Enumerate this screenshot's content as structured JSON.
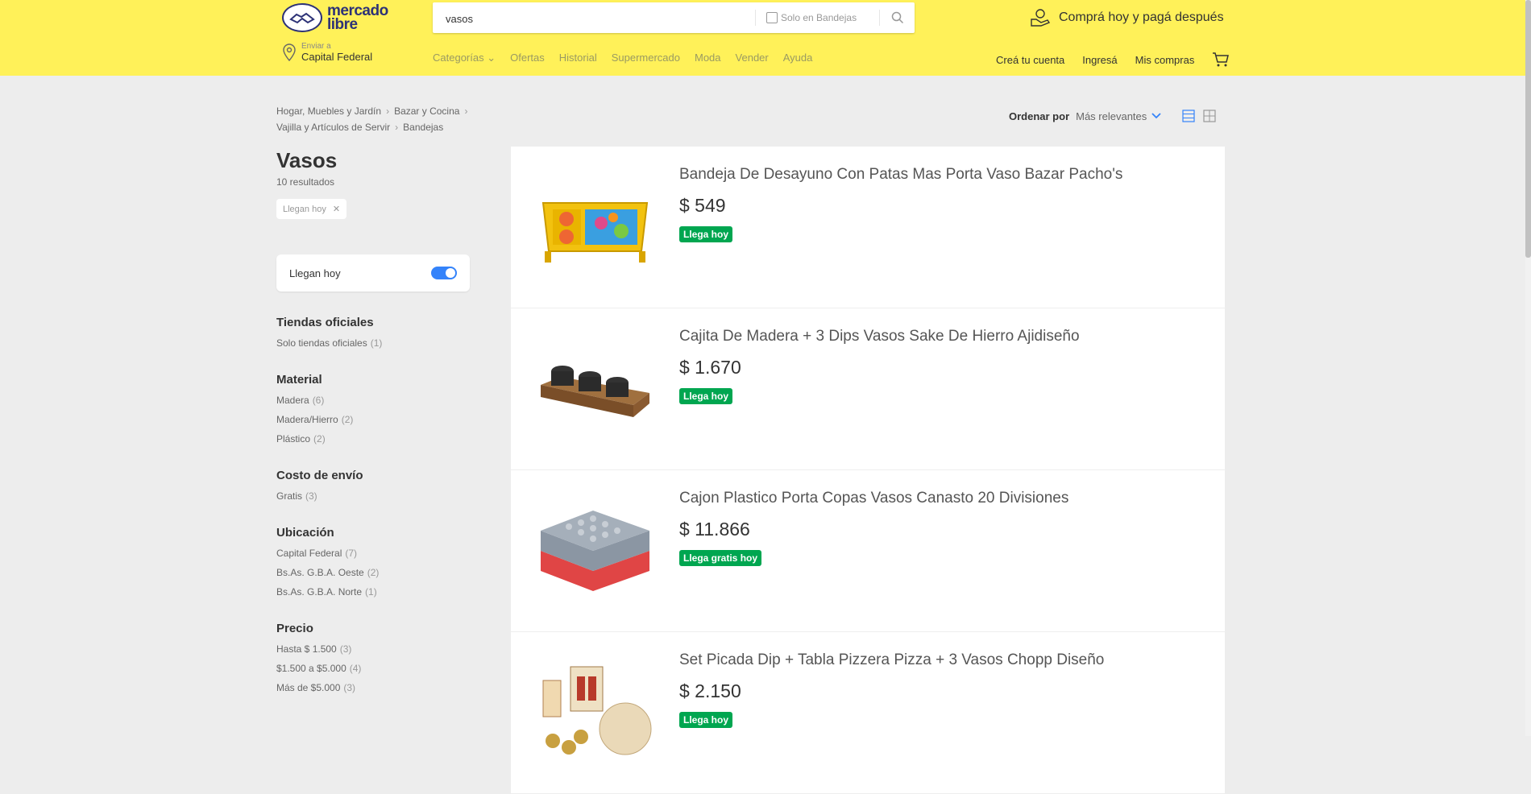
{
  "header": {
    "logo_line1": "mercado",
    "logo_line2": "libre",
    "search_value": "vasos",
    "search_checkbox_label": "Solo en Bandejas",
    "promo_text": "Comprá hoy y pagá después",
    "location_small": "Enviar a",
    "location_big": "Capital Federal",
    "nav": [
      "Categorías",
      "Ofertas",
      "Historial",
      "Supermercado",
      "Moda",
      "Vender",
      "Ayuda"
    ],
    "user_nav": [
      "Creá tu cuenta",
      "Ingresá",
      "Mis compras"
    ]
  },
  "breadcrumb": {
    "line1": [
      "Hogar, Muebles y Jardín",
      "Bazar y Cocina"
    ],
    "line2": [
      "Vajilla y Artículos de Servir",
      "Bandejas"
    ]
  },
  "sort": {
    "label": "Ordenar por",
    "value": "Más relevantes"
  },
  "sidebar": {
    "title": "Vasos",
    "count": "10 resultados",
    "chip": "Llegan hoy",
    "toggle_label": "Llegan hoy",
    "toggle_on": true,
    "filters": [
      {
        "title": "Tiendas oficiales",
        "items": [
          {
            "label": "Solo tiendas oficiales",
            "count": "(1)"
          }
        ]
      },
      {
        "title": "Material",
        "items": [
          {
            "label": "Madera",
            "count": "(6)"
          },
          {
            "label": "Madera/Hierro",
            "count": "(2)"
          },
          {
            "label": "Plástico",
            "count": "(2)"
          }
        ]
      },
      {
        "title": "Costo de envío",
        "items": [
          {
            "label": "Gratis",
            "count": "(3)"
          }
        ]
      },
      {
        "title": "Ubicación",
        "items": [
          {
            "label": "Capital Federal",
            "count": "(7)"
          },
          {
            "label": "Bs.As. G.B.A. Oeste",
            "count": "(2)"
          },
          {
            "label": "Bs.As. G.B.A. Norte",
            "count": "(1)"
          }
        ]
      },
      {
        "title": "Precio",
        "items": [
          {
            "label": "Hasta $ 1.500",
            "count": "(3)"
          },
          {
            "label": "$1.500 a $5.000",
            "count": "(4)"
          },
          {
            "label": "Más de $5.000",
            "count": "(3)"
          }
        ]
      }
    ]
  },
  "results": [
    {
      "title": "Bandeja De Desayuno Con Patas Mas Porta Vaso Bazar Pacho's",
      "price": "$ 549",
      "badge": "Llega hoy"
    },
    {
      "title": "Cajita De Madera + 3 Dips Vasos Sake De Hierro Ajidiseño",
      "price": "$ 1.670",
      "badge": "Llega hoy"
    },
    {
      "title": "Cajon Plastico Porta Copas Vasos Canasto 20 Divisiones",
      "price": "$ 11.866",
      "badge": "Llega gratis hoy"
    },
    {
      "title": "Set Picada Dip + Tabla Pizzera Pizza + 3 Vasos Chopp Diseño",
      "price": "$ 2.150",
      "badge": "Llega hoy"
    }
  ],
  "colors": {
    "header": "#fff159",
    "accent": "#3483fa",
    "badge": "#00a650"
  }
}
